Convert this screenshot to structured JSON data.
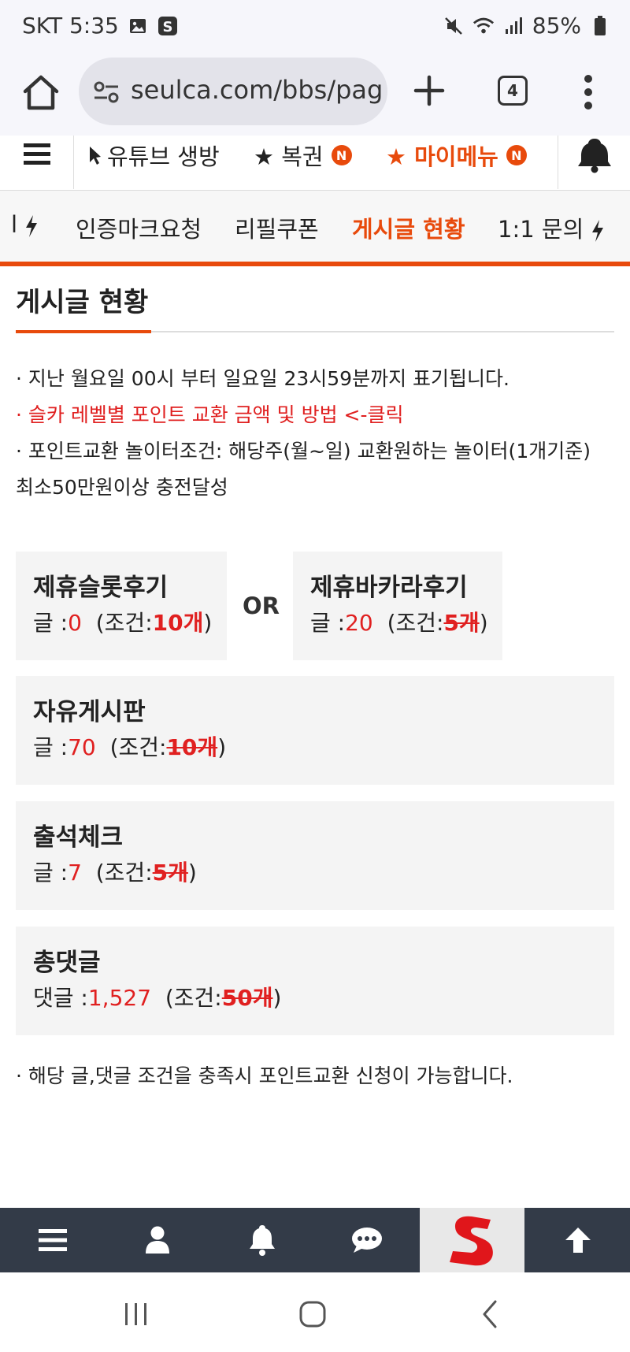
{
  "status_bar": {
    "carrier_time": "SKT 5:35",
    "battery": "85%",
    "icons": [
      "image-icon",
      "s-app-icon",
      "mute-icon",
      "wifi-icon",
      "signal-icon",
      "battery-icon"
    ]
  },
  "browser": {
    "url": "seulca.com/bbs/pag",
    "tab_count": "4"
  },
  "site_menu": {
    "item1": "유튜브 생방",
    "item2": "★ 복권",
    "item3": "★ 마이메뉴",
    "badge": "N"
  },
  "sub_tabs": {
    "partial_left": "l",
    "tab1": "인증마크요청",
    "tab2": "리필쿠폰",
    "tab3": "게시글 현황",
    "tab4": "1:1 문의"
  },
  "page": {
    "title": "게시글 현황",
    "notice1": "· 지난 월요일 00시 부터 일요일 23시59분까지 표기됩니다.",
    "notice2": "· 슬카 레벨별 포인트 교환 금액 및 방법 <-클릭",
    "notice3": "· 포인트교환 놀이터조건: 해당주(월~일) 교환원하는 놀이터(1개기준) 최소50만원이상 충전달성",
    "or_label": "OR",
    "final_note": "· 해당 글,댓글 조건을 충족시 포인트교환 신청이 가능합니다."
  },
  "boxes": {
    "slot": {
      "title": "제휴슬롯후기",
      "label": "글 :",
      "count": "0",
      "cond_prefix": "(조건:",
      "cond_value": "10개",
      "cond_suffix": ")"
    },
    "baccarat": {
      "title": "제휴바카라후기",
      "label": "글 :",
      "count": "20",
      "cond_prefix": "(조건:",
      "cond_value": "5개",
      "cond_suffix": ")"
    },
    "free": {
      "title": "자유게시판",
      "label": "글 :",
      "count": "70",
      "cond_prefix": "(조건:",
      "cond_value": "10개",
      "cond_suffix": ")"
    },
    "attendance": {
      "title": "출석체크",
      "label": "글 :",
      "count": "7",
      "cond_prefix": "(조건:",
      "cond_value": "5개",
      "cond_suffix": ")"
    },
    "comments": {
      "title": "총댓글",
      "label": "댓글 :",
      "count": "1,527",
      "cond_prefix": "(조건:",
      "cond_value": "50개",
      "cond_suffix": ")"
    }
  },
  "colors": {
    "accent": "#e84a0c",
    "red": "#e02020",
    "bottom_nav": "#333b48",
    "box_bg": "#f4f4f4"
  }
}
